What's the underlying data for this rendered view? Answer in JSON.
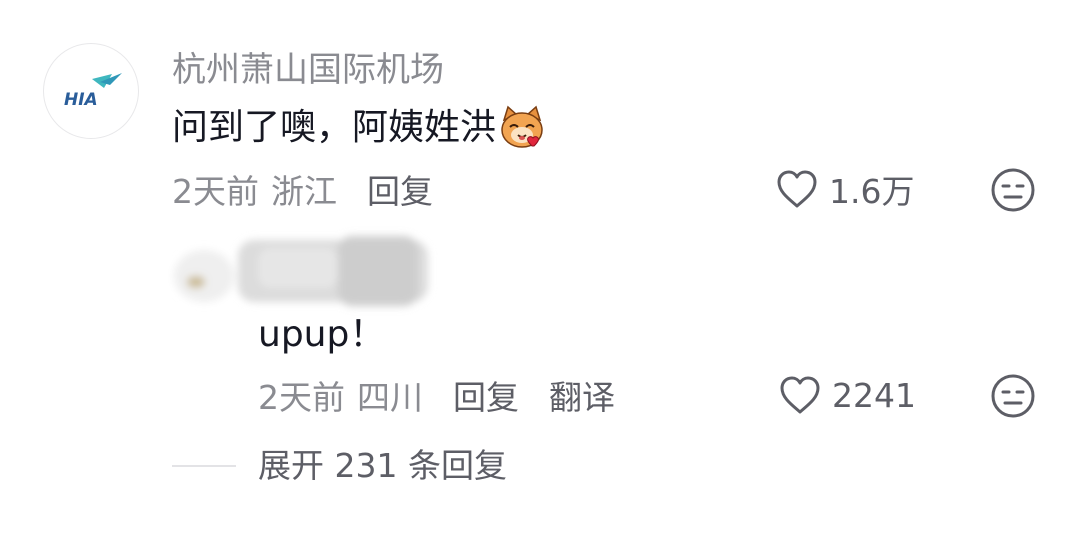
{
  "comment": {
    "avatar_icon": "hia-airport-logo",
    "avatar_logo_text": "HIA",
    "username": "杭州萧山国际机场",
    "text": "问到了噢，阿姨姓洪",
    "emoji_icon": "smiling-cat-with-heart-emoji",
    "time": "2天前",
    "location": "浙江",
    "reply_label": "回复",
    "like_icon": "heart-outline-icon",
    "like_count": "1.6万",
    "dislike_icon": "meh-face-icon"
  },
  "reply": {
    "avatar_and_name": "blurred",
    "text": "upup！",
    "time": "2天前",
    "location": "四川",
    "reply_label": "回复",
    "translate_label": "翻译",
    "like_icon": "heart-outline-icon",
    "like_count": "2241",
    "dislike_icon": "meh-face-icon"
  },
  "expand": {
    "label": "展开 231 条回复"
  },
  "colors": {
    "primary_text": "#161823",
    "secondary_text": "#8a8b91",
    "action_text": "#5d5e66",
    "logo_blue": "#2a5d9a",
    "logo_teal": "#3fb7bf"
  }
}
